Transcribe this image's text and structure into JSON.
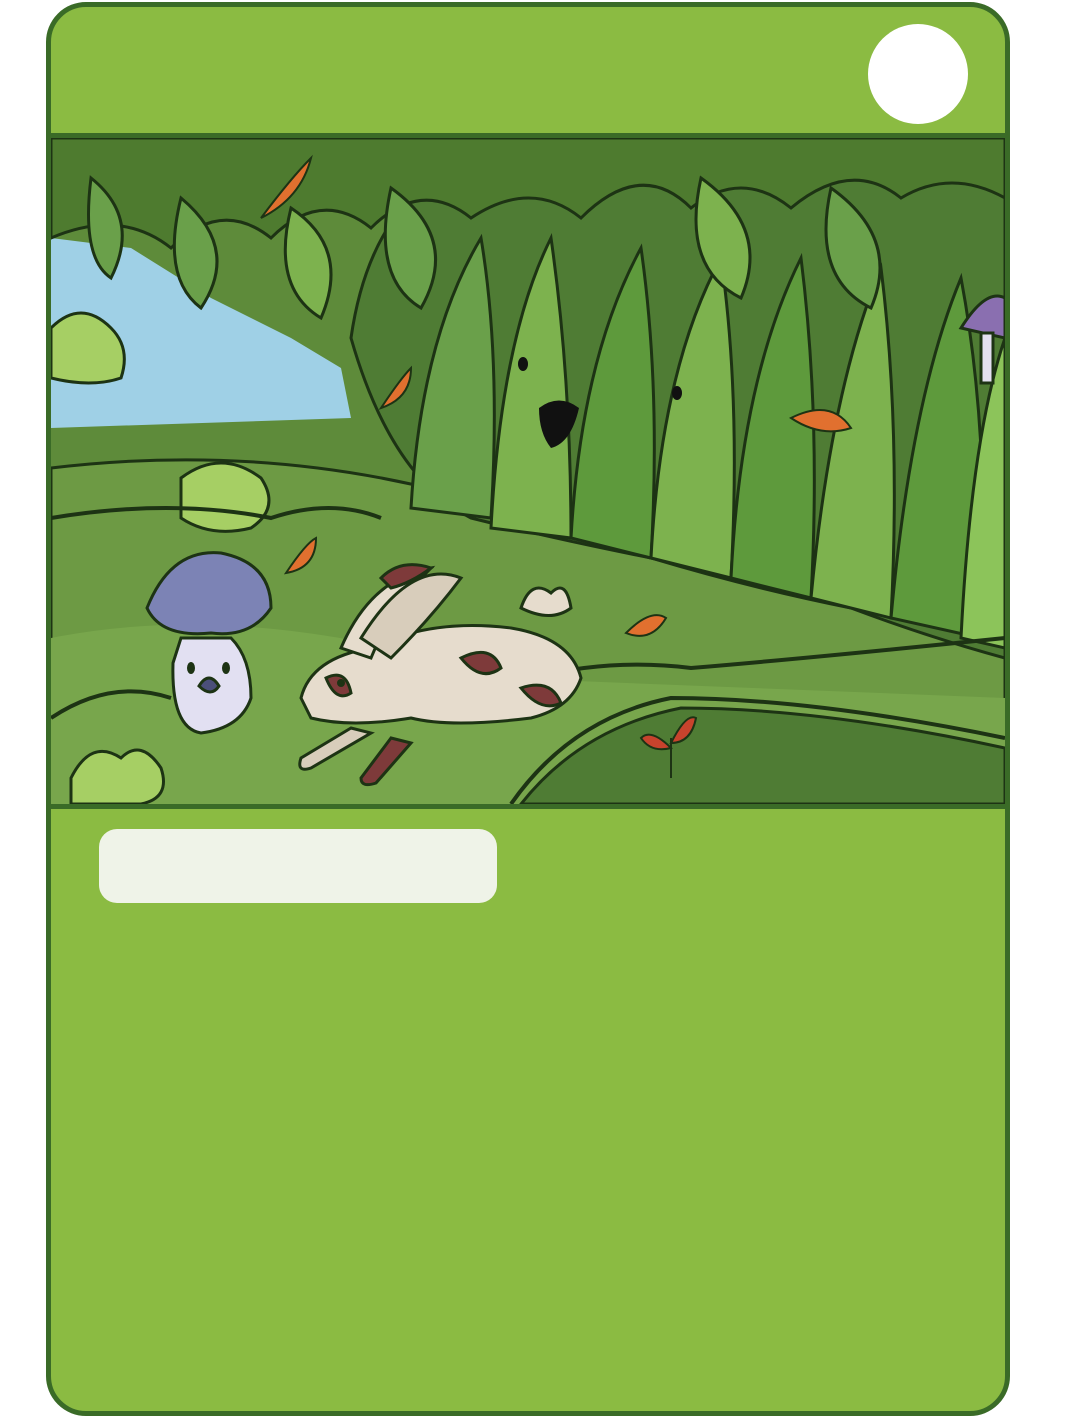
{
  "card": {
    "title": "",
    "description": "",
    "colors": {
      "card_fill": "#8bbb42",
      "card_border": "#3a6b27",
      "plate_fill": "#eff3e8",
      "corner_badge": "#ffffff"
    },
    "illustration": {
      "characters": [
        "mushroom-character",
        "spotted-rabbit",
        "vine-tree-face"
      ]
    }
  }
}
